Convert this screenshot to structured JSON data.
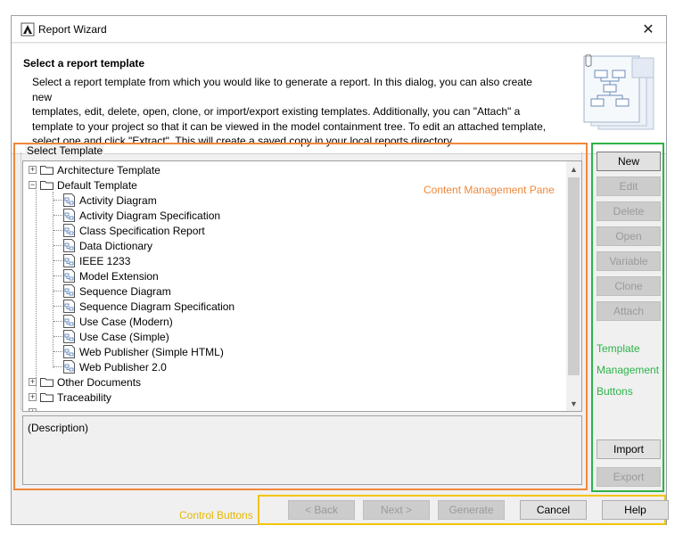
{
  "window": {
    "title": "Report Wizard",
    "close_glyph": "✕"
  },
  "header": {
    "title": "Select a report template",
    "description_lines": [
      "Select a report template from which you would like to generate a report. In this dialog, you can also create new",
      "templates, edit, delete, open, clone, or import/export existing templates. Additionally, you can \"Attach\" a",
      "template to your project so that it can be viewed in the model containment tree. To edit an attached template,",
      "select one and click \"Extract\". This will create a saved copy in your local reports directory."
    ]
  },
  "content": {
    "group_label": "Select Template",
    "annotation": "Content Management Pane",
    "tree": {
      "architecture": "Architecture Template",
      "default": "Default Template",
      "default_children": [
        "Activity Diagram",
        "Activity Diagram Specification",
        "Class Specification Report",
        "Data Dictionary",
        "IEEE 1233",
        "Model Extension",
        "Sequence Diagram",
        "Sequence Diagram Specification",
        "Use Case (Modern)",
        "Use Case (Simple)",
        "Web Publisher (Simple HTML)",
        "Web Publisher 2.0"
      ],
      "other": "Other Documents",
      "traceability": "Traceability"
    },
    "description": "(Description)"
  },
  "template_buttons": {
    "new": "New",
    "edit": "Edit",
    "delete": "Delete",
    "open": "Open",
    "variable": "Variable",
    "clone": "Clone",
    "attach": "Attach",
    "import": "Import",
    "export": "Export",
    "annotation_lines": [
      "Template",
      "Management",
      "Buttons"
    ]
  },
  "control_buttons": {
    "annotation": "Control Buttons",
    "back": "< Back",
    "next": "Next >",
    "generate": "Generate",
    "cancel": "Cancel",
    "help": "Help"
  },
  "colors": {
    "content_pane": "#f0883a",
    "template_pane": "#2db34a",
    "control_pane": "#f5c400"
  }
}
